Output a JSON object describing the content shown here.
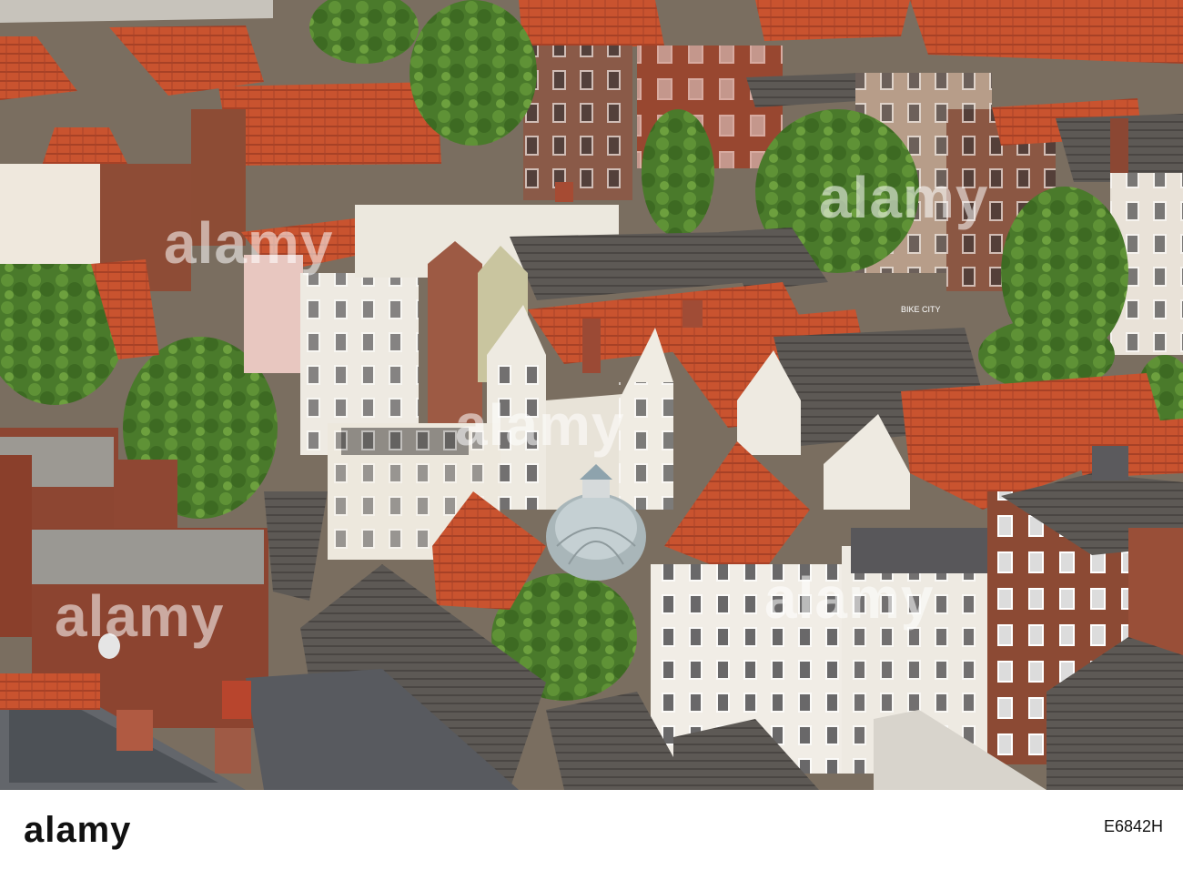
{
  "photo": {
    "subject": "Aerial view of old town rooftops with red tiled gabled roofs",
    "watermark_text": "alamy",
    "shop_sign": "BIKE CITY"
  },
  "footer": {
    "logo_text": "alamy",
    "image_id": "E6842H"
  },
  "colors": {
    "roof_red": "#c8512f",
    "roof_grey": "#5b5753",
    "wall_white": "#eeeae0",
    "brick": "#8e4a35",
    "tree_green": "#4d7a2c",
    "footer_bg": "#ffffff"
  }
}
